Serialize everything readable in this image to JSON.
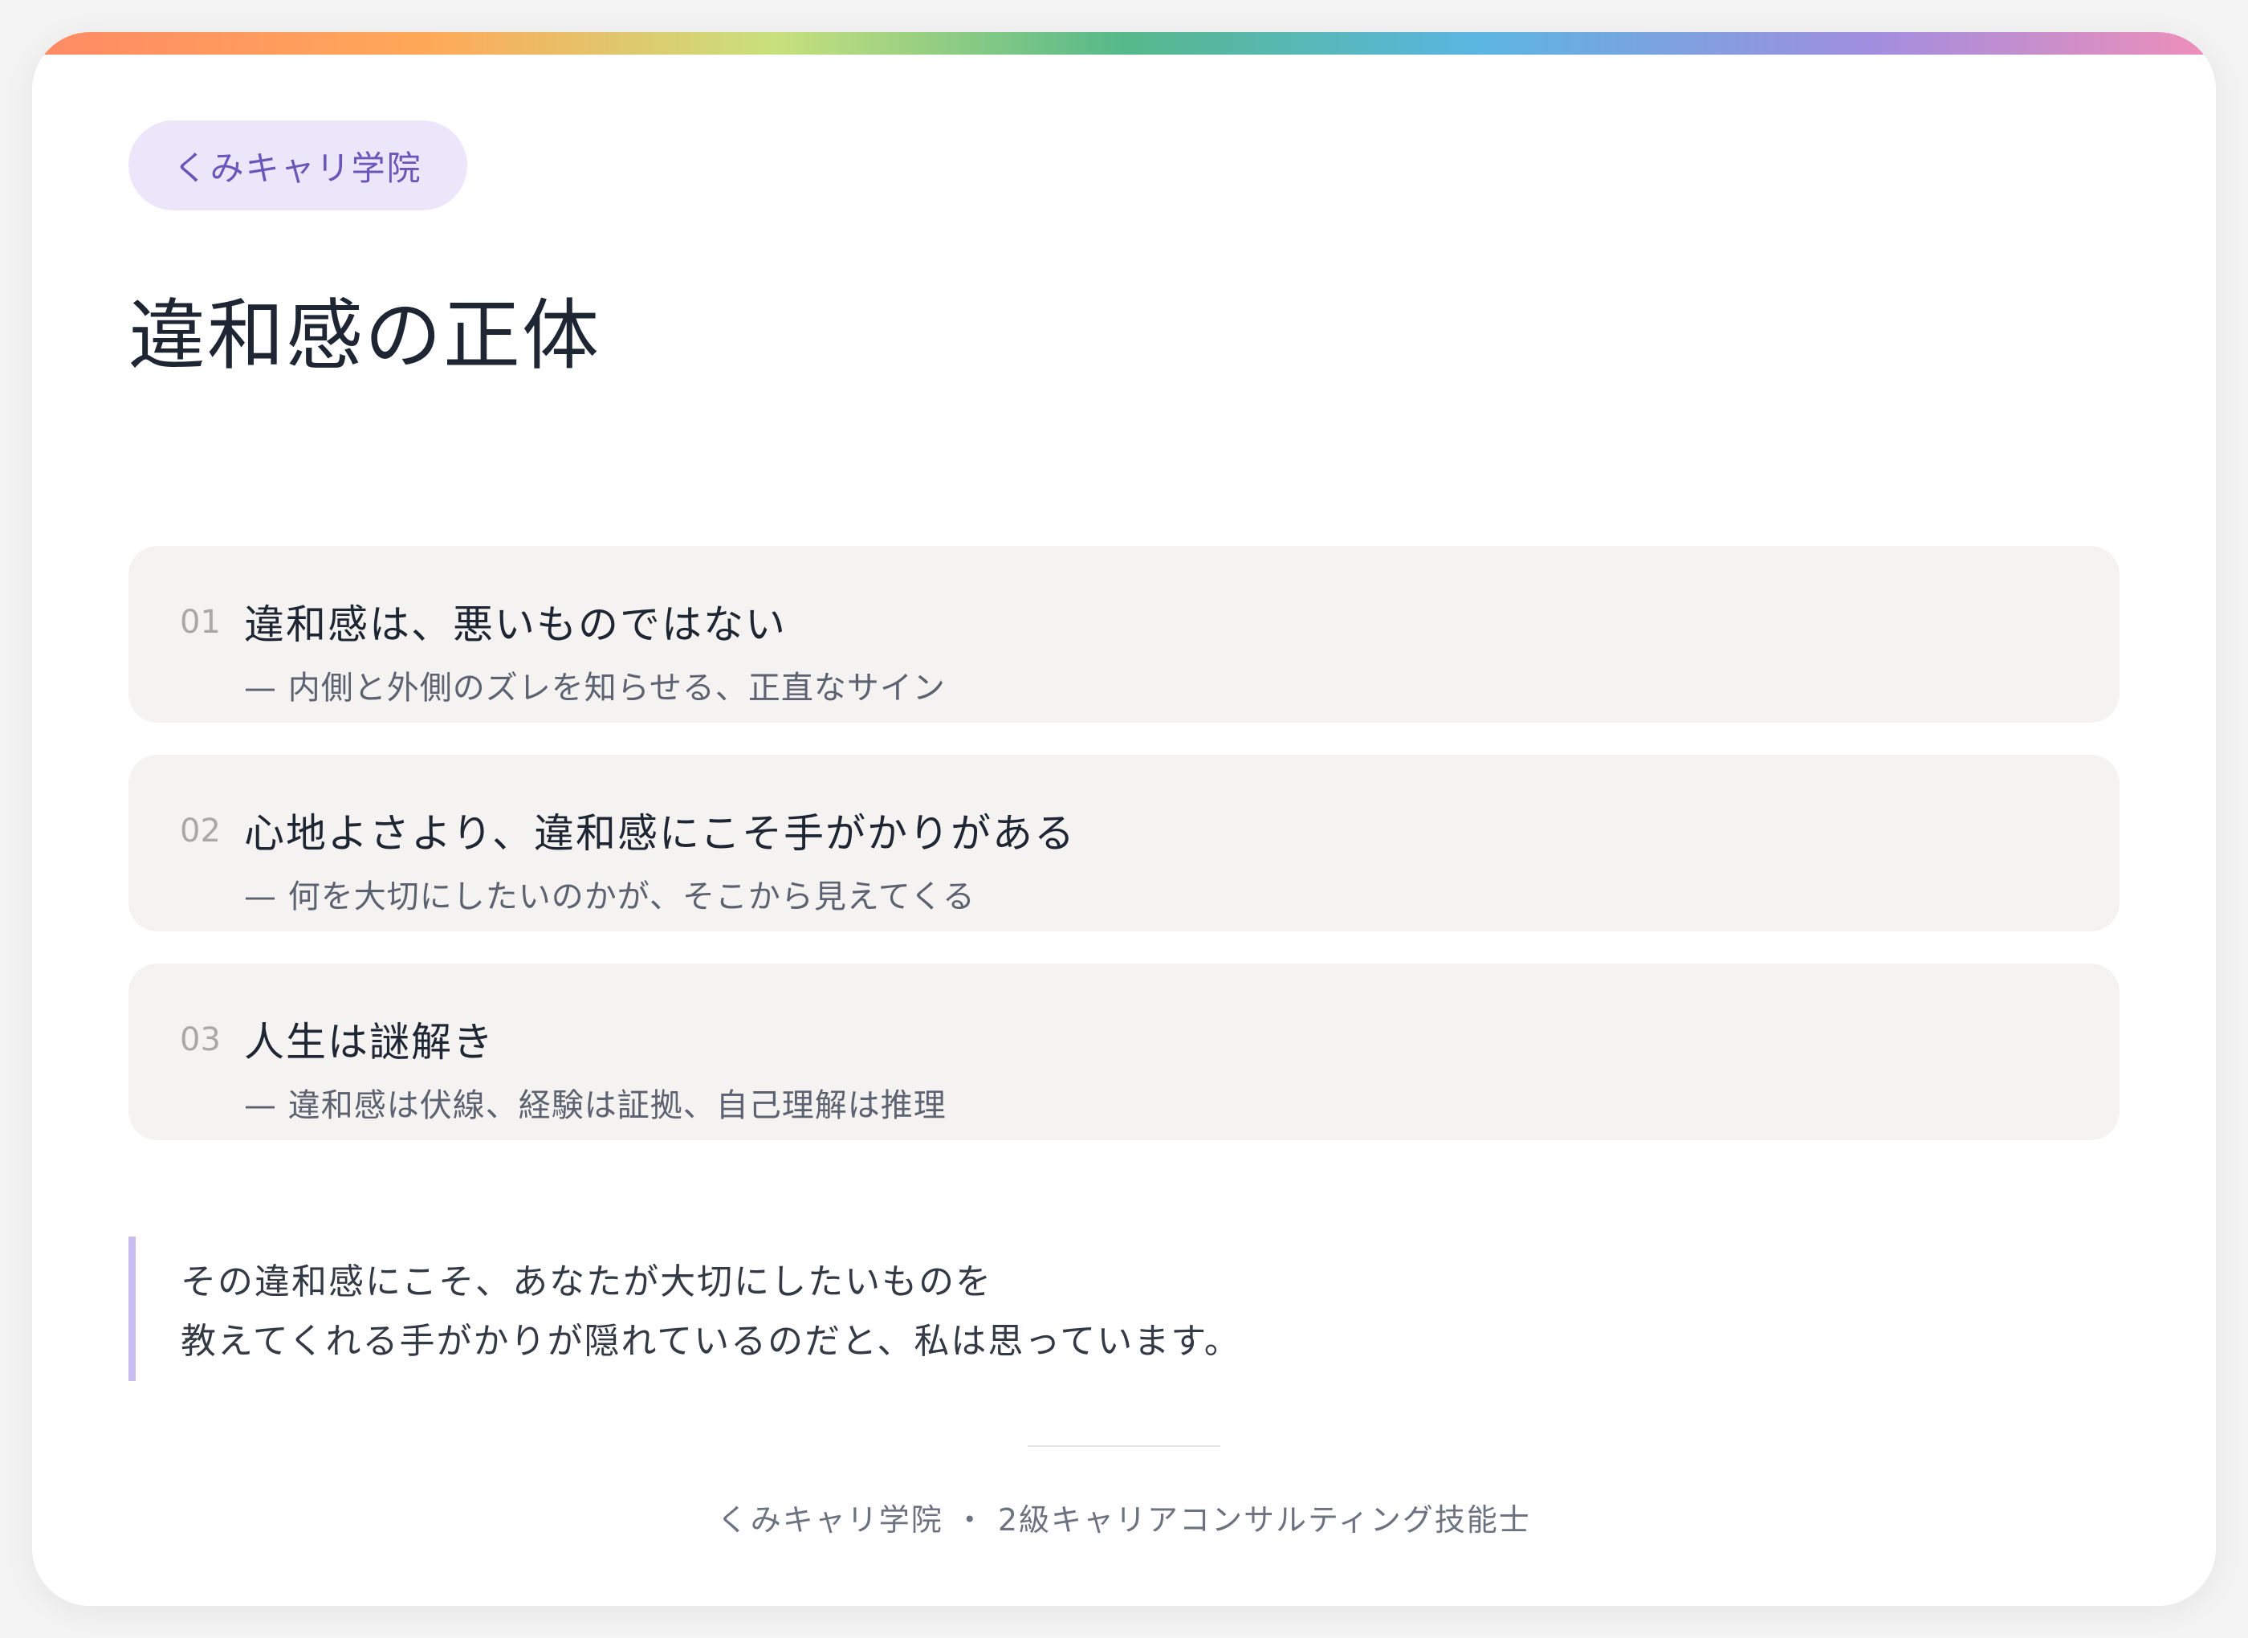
{
  "badge": {
    "label": "くみキャリ学院"
  },
  "title": "違和感の正体",
  "points": [
    {
      "number": "01",
      "heading": "違和感は、悪いものではない",
      "sub": "— 内側と外側のズレを知らせる、正直なサイン"
    },
    {
      "number": "02",
      "heading": "心地よさより、違和感にこそ手がかりがある",
      "sub": "— 何を大切にしたいのかが、そこから見えてくる"
    },
    {
      "number": "03",
      "heading": "人生は謎解き",
      "sub": "— 違和感は伏線、経験は証拠、自己理解は推理"
    }
  ],
  "quote": {
    "line1": "その違和感にこそ、あなたが大切にしたいものを",
    "line2": "教えてくれる手がかりが隠れているのだと、私は思っています。"
  },
  "footer": "くみキャリ学院 ・ 2級キャリアコンサルティング技能士",
  "colors": {
    "badge_bg": "#ece6fb",
    "badge_text": "#6a55b8",
    "quote_border": "#c8bdf0",
    "card_bg": "#f4f3f1"
  }
}
